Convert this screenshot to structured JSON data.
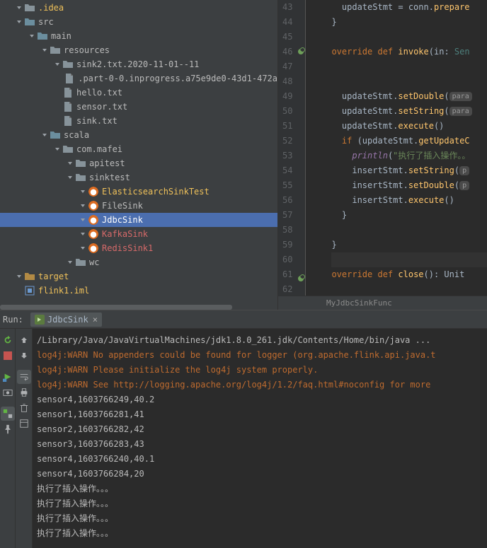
{
  "tree": {
    "items": [
      {
        "depth": 1,
        "arrow": "down",
        "icon": "folder",
        "label": ".idea",
        "labelClass": "highlight"
      },
      {
        "depth": 1,
        "arrow": "down",
        "icon": "folder-blue",
        "label": "src"
      },
      {
        "depth": 2,
        "arrow": "down",
        "icon": "folder-blue",
        "label": "main"
      },
      {
        "depth": 3,
        "arrow": "down",
        "icon": "folder",
        "label": "resources"
      },
      {
        "depth": 4,
        "arrow": "down",
        "icon": "folder",
        "label": "sink2.txt.2020-11-01--11"
      },
      {
        "depth": 5,
        "arrow": "none",
        "icon": "file",
        "label": ".part-0-0.inprogress.a75e9de0-43d1-472a"
      },
      {
        "depth": 4,
        "arrow": "none",
        "icon": "file",
        "label": "hello.txt"
      },
      {
        "depth": 4,
        "arrow": "none",
        "icon": "file",
        "label": "sensor.txt"
      },
      {
        "depth": 4,
        "arrow": "none",
        "icon": "file",
        "label": "sink.txt"
      },
      {
        "depth": 3,
        "arrow": "down",
        "icon": "folder-blue",
        "label": "scala"
      },
      {
        "depth": 4,
        "arrow": "down",
        "icon": "folder",
        "label": "com.mafei"
      },
      {
        "depth": 5,
        "arrow": "right",
        "icon": "folder",
        "label": "apitest"
      },
      {
        "depth": 5,
        "arrow": "down",
        "icon": "folder",
        "label": "sinktest"
      },
      {
        "depth": 6,
        "arrow": "right",
        "icon": "scala",
        "label": "ElasticsearchSinkTest",
        "labelClass": "highlight"
      },
      {
        "depth": 6,
        "arrow": "right",
        "icon": "scala",
        "label": "FileSink"
      },
      {
        "depth": 6,
        "arrow": "right",
        "icon": "scala",
        "label": "JdbcSink",
        "selected": true
      },
      {
        "depth": 6,
        "arrow": "right",
        "icon": "scala",
        "label": "KafkaSink",
        "labelClass": "red"
      },
      {
        "depth": 6,
        "arrow": "right",
        "icon": "scala",
        "label": "RedisSink1",
        "labelClass": "red"
      },
      {
        "depth": 5,
        "arrow": "right",
        "icon": "folder",
        "label": "wc"
      },
      {
        "depth": 1,
        "arrow": "right",
        "icon": "folder-yellow",
        "label": "target",
        "labelClass": "highlight"
      },
      {
        "depth": 1,
        "arrow": "none",
        "icon": "iml",
        "label": "flink1.iml",
        "labelClass": "highlight"
      }
    ]
  },
  "editor": {
    "startLine": 43,
    "lines": [
      {
        "n": 43,
        "html": "  updateStmt = conn.<span class='fn'>prepare</span>"
      },
      {
        "n": 44,
        "html": "}"
      },
      {
        "n": 45,
        "html": ""
      },
      {
        "n": 46,
        "html": "<span class='kw'>override</span> <span class='kw'>def</span> <span class='fn'>invoke</span>(in: <span style='color:#4e807d'>Sen</span>",
        "mark": "override"
      },
      {
        "n": 47,
        "html": ""
      },
      {
        "n": 48,
        "html": ""
      },
      {
        "n": 49,
        "html": "  updateStmt.<span class='fn'>setDouble</span>(<span class='param-hint'>para</span>"
      },
      {
        "n": 50,
        "html": "  updateStmt.<span class='fn'>setString</span>(<span class='param-hint'>para</span>"
      },
      {
        "n": 51,
        "html": "  updateStmt.<span class='fn'>execute</span>()"
      },
      {
        "n": 52,
        "html": "  <span class='kw'>if</span> (updateStmt.<span class='fn'>getUpdateC</span>"
      },
      {
        "n": 53,
        "html": "    <span style='color:#9876aa;font-style:italic'>println</span>(<span class='str'>\"执行了插入操作。。</span>"
      },
      {
        "n": 54,
        "html": "    insertStmt.<span class='fn'>setString</span>(<span class='param-hint'>p</span>"
      },
      {
        "n": 55,
        "html": "    insertStmt.<span class='fn'>setDouble</span>(<span class='param-hint'>p</span>"
      },
      {
        "n": 56,
        "html": "    insertStmt.<span class='fn'>execute</span>()"
      },
      {
        "n": 57,
        "html": "  }"
      },
      {
        "n": 58,
        "html": ""
      },
      {
        "n": 59,
        "html": "}"
      },
      {
        "n": 60,
        "html": "",
        "hl": true
      },
      {
        "n": 61,
        "html": "<span class='kw'>override</span> <span class='kw'>def</span> <span class='fn'>close</span>(): Unit",
        "mark": "override"
      },
      {
        "n": 62,
        "html": ""
      }
    ],
    "breadcrumb": "MyJdbcSinkFunc"
  },
  "run": {
    "label": "Run:",
    "tab": "JdbcSink",
    "toolbarLeft": [
      "rerun",
      "stop",
      "restart-debug",
      "camera",
      "toggle",
      "pin"
    ],
    "toolbarRight": [
      "up",
      "down",
      "wrap",
      "print",
      "clear",
      "expand"
    ],
    "console": [
      {
        "t": "/Library/Java/JavaVirtualMachines/jdk1.8.0_261.jdk/Contents/Home/bin/java ...",
        "c": ""
      },
      {
        "t": "log4j:WARN No appenders could be found for logger (org.apache.flink.api.java.t",
        "c": "warn"
      },
      {
        "t": "log4j:WARN Please initialize the log4j system properly.",
        "c": "warn"
      },
      {
        "t": "log4j:WARN See ",
        "link": "http://logging.apache.org/log4j/1.2/faq.html#noconfig",
        "tail": " for more",
        "c": "warn"
      },
      {
        "t": "sensor4,1603766249,40.2",
        "c": ""
      },
      {
        "t": "sensor1,1603766281,41",
        "c": ""
      },
      {
        "t": "sensor2,1603766282,42",
        "c": ""
      },
      {
        "t": "sensor3,1603766283,43",
        "c": ""
      },
      {
        "t": "sensor4,1603766240,40.1",
        "c": ""
      },
      {
        "t": "sensor4,1603766284,20",
        "c": ""
      },
      {
        "t": "执行了插入操作。。。",
        "c": ""
      },
      {
        "t": "执行了插入操作。。。",
        "c": ""
      },
      {
        "t": "执行了插入操作。。。",
        "c": ""
      },
      {
        "t": "执行了插入操作。。。",
        "c": ""
      }
    ]
  }
}
